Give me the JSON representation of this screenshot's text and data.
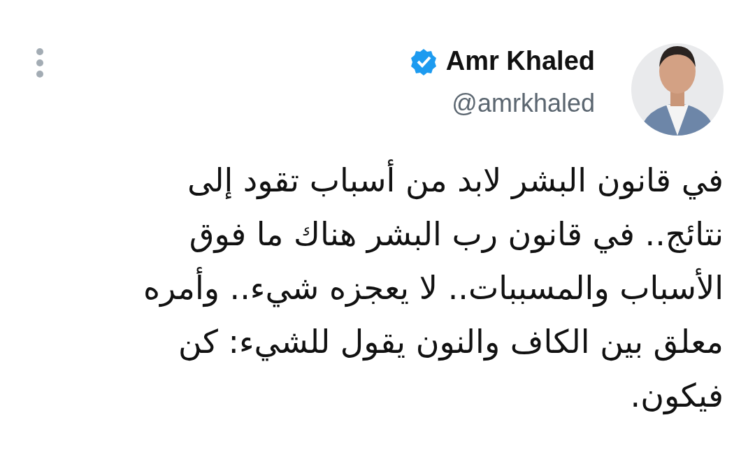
{
  "author": {
    "name": "Amr Khaled",
    "handle": "@amrkhaled",
    "verified": true
  },
  "tweet": {
    "text": "في قانون البشر لابد من أسباب تقود إلى\nنتائج.. في قانون رب البشر هناك ما فوق\nالأسباب والمسببات.. لا يعجزه شيء.. وأمره\nمعلق بين الكاف والنون يقول للشيء: كن\nفيكون."
  }
}
